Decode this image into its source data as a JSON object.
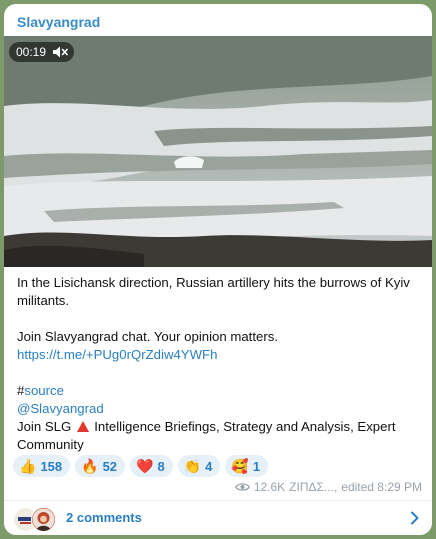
{
  "post": {
    "channel": "Slavyangrad",
    "video": {
      "duration": "00:19",
      "icon": "muted-speaker-icon"
    },
    "lines": {
      "l1": "In the Lisichansk direction, Russian artillery hits the burrows of Kyiv militants.",
      "l2": "Join Slavyangrad chat. Your opinion matters.",
      "l3": "https://t.me/+PUg0rQrZdiw4YWFh",
      "l4_hash": "#",
      "l4_tag": "source",
      "l5": "@Slavyangrad",
      "l6a": "Join SLG",
      "l6b": "Intelligence Briefings, Strategy and Analysis, Expert Community"
    },
    "reactions": [
      {
        "emoji": "👍",
        "count": "158"
      },
      {
        "emoji": "🔥",
        "count": "52"
      },
      {
        "emoji": "❤️",
        "count": "8"
      },
      {
        "emoji": "👏",
        "count": "4"
      },
      {
        "emoji": "🥰",
        "count": "1"
      }
    ],
    "meta": {
      "views": "12.6K",
      "author": "ΖΙΠΔΣ...,",
      "edited": "edited 8:29 PM",
      "icon": "eye-icon"
    },
    "comments": {
      "label": "2 comments",
      "icon": "chevron-right-icon"
    }
  },
  "colors": {
    "accent": "#2a7fc1",
    "channel": "#3a8cc7",
    "reaction_bg": "#e6f0f8",
    "meta": "#9aa3ab",
    "background": "#7d9a6a"
  }
}
